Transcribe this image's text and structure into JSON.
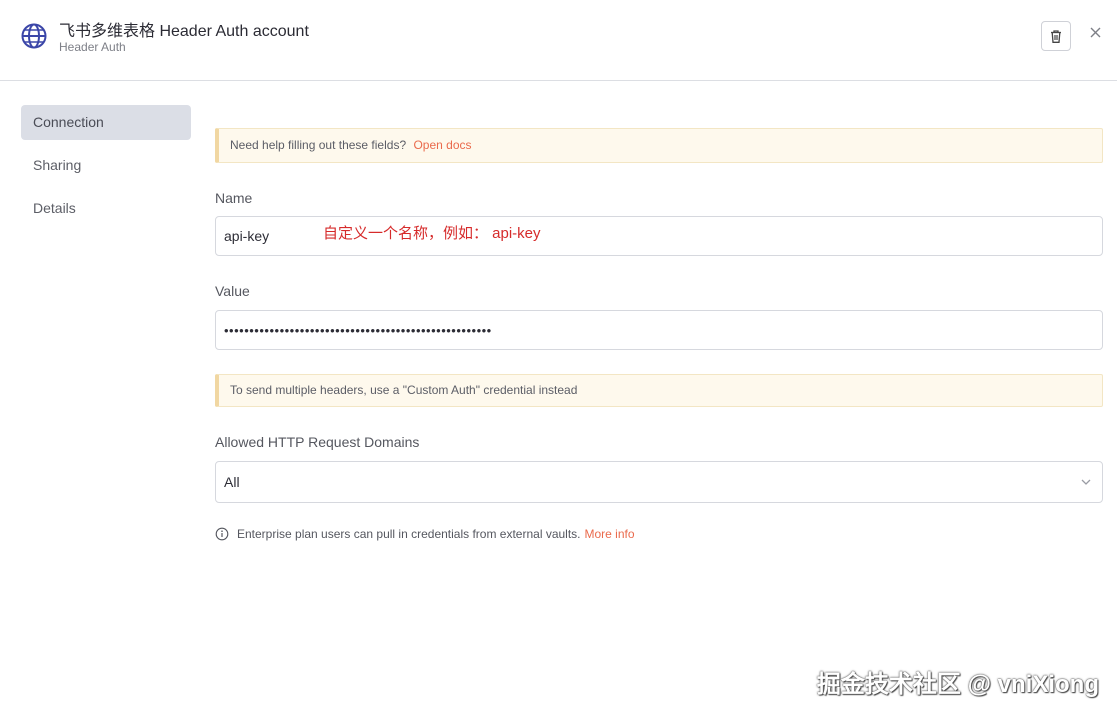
{
  "header": {
    "title": "飞书多维表格 Header Auth account",
    "subtitle": "Header Auth",
    "icon": "globe-icon"
  },
  "sidebar": {
    "items": [
      {
        "label": "Connection",
        "active": true
      },
      {
        "label": "Sharing",
        "active": false
      },
      {
        "label": "Details",
        "active": false
      }
    ]
  },
  "main": {
    "help_notice": {
      "text": "Need help filling out these fields?",
      "link": "Open docs"
    },
    "name_field": {
      "label": "Name",
      "value": "api-key",
      "annotation": "自定义一个名称，例如： api-key"
    },
    "value_field": {
      "label": "Value",
      "value": "•••••••••••••••••••••••••••••••••••••••••••••••••••••"
    },
    "headers_notice": {
      "text": "To send multiple headers, use a \"Custom Auth\" credential instead"
    },
    "domains_field": {
      "label": "Allowed HTTP Request Domains",
      "selected": "All"
    },
    "enterprise_info": {
      "text": "Enterprise plan users can pull in credentials from external vaults.",
      "link": "More info"
    }
  },
  "watermark": "掘金技术社区 @ vniXiong",
  "colors": {
    "accent": "#ea6a4c",
    "globe": "#3b46a8",
    "annotation": "#d62b2b",
    "notice_bg": "#fef9ed",
    "notice_border": "#f1d7a2",
    "active_item_bg": "#dbdee6"
  }
}
